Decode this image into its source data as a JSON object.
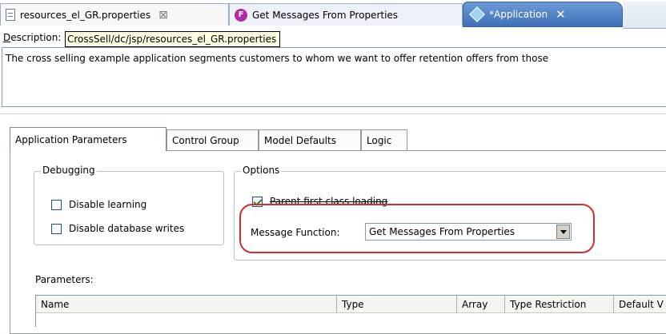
{
  "editor_tabs": [
    {
      "label": "resources_el_GR.properties",
      "close": "⊠"
    },
    {
      "label": "Get Messages From Properties",
      "icon_text": "F"
    },
    {
      "label": "*Application",
      "close": "✕"
    }
  ],
  "description": {
    "label": "Description:",
    "tooltip": "CrossSell/dc/jsp/resources_el_GR.properties",
    "text": "The cross selling example application segments customers to whom we want to offer retention offers from those"
  },
  "form_tabs": [
    "Application Parameters",
    "Control Group",
    "Model Defaults",
    "Logic"
  ],
  "debugging": {
    "title": "Debugging",
    "disable_learning": "Disable learning",
    "disable_database_writes": "Disable database writes"
  },
  "options": {
    "title": "Options",
    "parent_first": "Parent first class loading",
    "message_function_label": "Message Function:",
    "message_function_value": "Get Messages From Properties"
  },
  "parameters": {
    "label": "Parameters:",
    "columns": [
      "Name",
      "Type",
      "Array",
      "Type Restriction",
      "Default V"
    ]
  },
  "colors": {
    "highlight": "#d62c2c",
    "active_tab": "#3f6fb8"
  }
}
